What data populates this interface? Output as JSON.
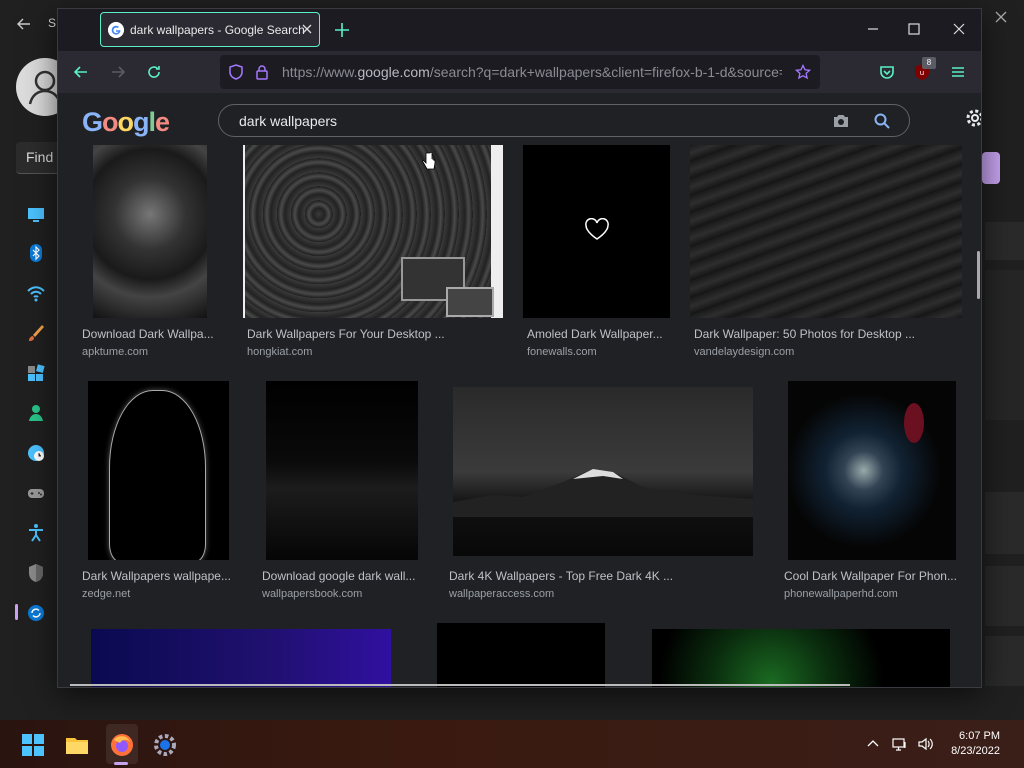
{
  "background_window": {
    "title_fragment": "S",
    "find_label": "Find",
    "accent_color": "#c7a3f0"
  },
  "browser": {
    "tab": {
      "title": "dark wallpapers - Google Search"
    },
    "url": {
      "prefix": "https://www.",
      "domain": "google.com",
      "rest": "/search?q=dark+wallpapers&client=firefox-b-1-d&source="
    },
    "extension_badge": "8",
    "accent_color": "#5af0c8"
  },
  "google": {
    "logo_letters": [
      "G",
      "o",
      "o",
      "g",
      "l",
      "e"
    ],
    "logo_colors": [
      "#8ab4f8",
      "#f28b82",
      "#fdd663",
      "#8ab4f8",
      "#81c995",
      "#f28b82"
    ],
    "search_query": "dark wallpapers"
  },
  "results": [
    {
      "caption": "Download Dark Wallpa...",
      "source": "apktume.com"
    },
    {
      "caption": "Dark Wallpapers For Your Desktop ...",
      "source": "hongkiat.com"
    },
    {
      "caption": "Amoled Dark Wallpaper...",
      "source": "fonewalls.com"
    },
    {
      "caption": "Dark Wallpaper: 50 Photos for Desktop ...",
      "source": "vandelaydesign.com"
    },
    {
      "caption": "Dark Wallpapers wallpape...",
      "source": "zedge.net"
    },
    {
      "caption": "Download google dark wall...",
      "source": "wallpapersbook.com"
    },
    {
      "caption": "Dark 4K Wallpapers - Top Free Dark 4K ...",
      "source": "wallpaperaccess.com"
    },
    {
      "caption": "Cool Dark Wallpaper For Phon...",
      "source": "phonewallpaperhd.com"
    }
  ],
  "taskbar": {
    "time": "6:07 PM",
    "date": "8/23/2022"
  }
}
